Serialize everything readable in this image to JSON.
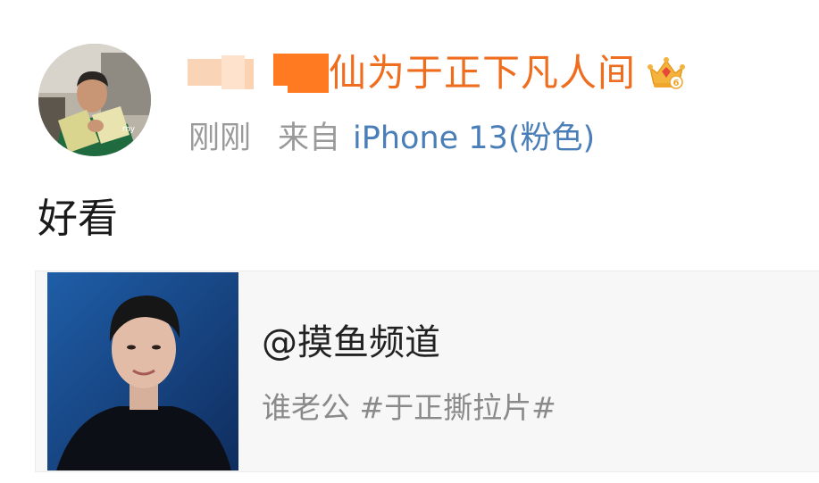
{
  "post": {
    "username": "仙为于正下凡人间",
    "time": "刚刚",
    "from_label": "来自",
    "device": "iPhone 13(粉色)",
    "text": "好看",
    "badge_icon": "crown-vip-icon"
  },
  "quote": {
    "author": "@摸鱼频道",
    "text": "谁老公 #于正撕拉片#"
  },
  "colors": {
    "username": "#ee6d1f",
    "meta_gray": "#9a9a9a",
    "link_blue": "#4a7eb8",
    "card_bg": "#f7f7f7"
  }
}
